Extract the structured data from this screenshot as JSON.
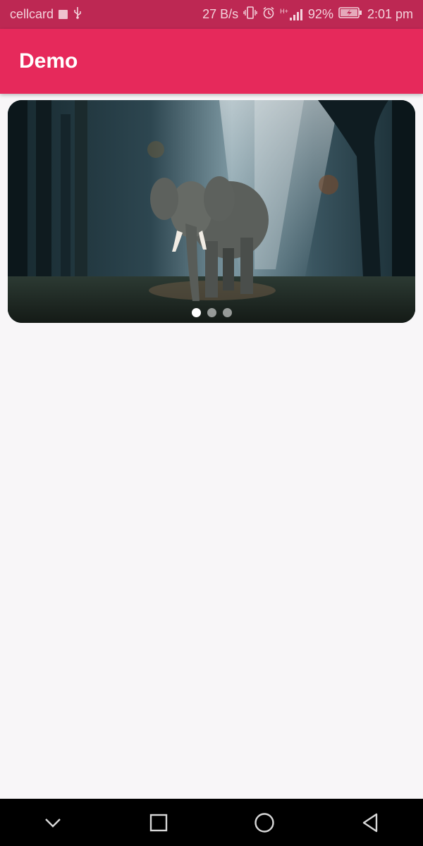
{
  "status_bar": {
    "carrier": "cellcard",
    "net_speed": "27 B/s",
    "signal_tag": "H+",
    "battery": "92%",
    "time": "2:01 pm",
    "icons": [
      "notification-icon",
      "usb-icon",
      "vibrate-icon",
      "alarm-icon",
      "signal-icon",
      "battery-charging-icon"
    ]
  },
  "app_bar": {
    "title": "Demo",
    "color": "#e6295b"
  },
  "carousel": {
    "image": "elephant-in-forest-image",
    "slide_count": 3,
    "active_index": 0
  },
  "nav_bar": {
    "buttons": [
      "chevron-down-icon",
      "recents-square-icon",
      "home-circle-icon",
      "back-triangle-icon"
    ]
  }
}
